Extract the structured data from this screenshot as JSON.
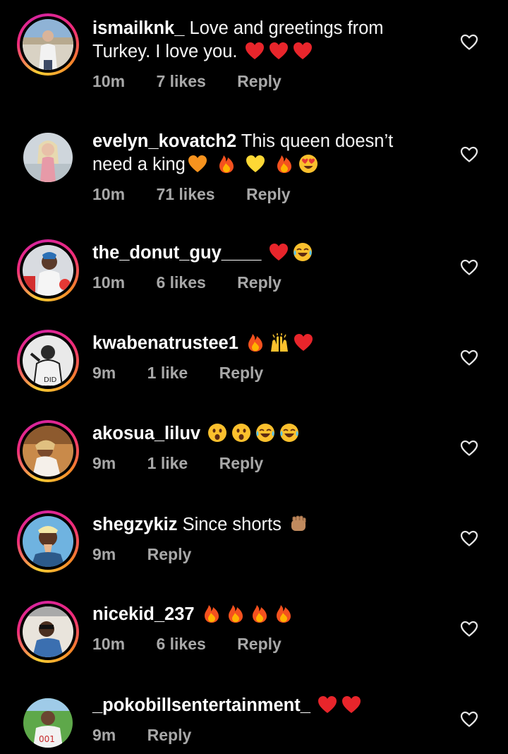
{
  "comments": [
    {
      "username": "ismailknk_",
      "text_line1": "Love and greetings from",
      "text_line2": "Turkey. I love you.",
      "emojis_line1": [],
      "emojis_line2": [
        "red-heart",
        "red-heart",
        "red-heart"
      ],
      "time": "10m",
      "likes": "7 likes",
      "reply": "Reply",
      "story_ring": true
    },
    {
      "username": "evelyn_kovatch2",
      "text_line1": "This queen doesn’t",
      "text_line2": "need a king",
      "emojis_line1": [],
      "emojis_line2": [
        "orange-heart",
        "fire",
        "yellow-heart",
        "fire",
        "heart-eyes"
      ],
      "time": "10m",
      "likes": "71 likes",
      "reply": "Reply",
      "story_ring": false
    },
    {
      "username": "the_donut_guy____",
      "text_line1": "",
      "emojis_line1": [
        "red-heart",
        "tears-of-joy"
      ],
      "time": "10m",
      "likes": "6 likes",
      "reply": "Reply",
      "story_ring": true
    },
    {
      "username": "kwabenatrustee1",
      "text_line1": "",
      "emojis_line1": [
        "fire",
        "raising-hands",
        "red-heart"
      ],
      "time": "9m",
      "likes": "1 like",
      "reply": "Reply",
      "story_ring": true
    },
    {
      "username": "akosua_liluv",
      "text_line1": "",
      "emojis_line1": [
        "astonished",
        "astonished",
        "tears-of-joy",
        "tears-of-joy"
      ],
      "time": "9m",
      "likes": "1 like",
      "reply": "Reply",
      "story_ring": true
    },
    {
      "username": "shegzykiz",
      "text_line1": "Since shorts",
      "emojis_line1": [
        "raised-fist"
      ],
      "time": "9m",
      "likes": "",
      "reply": "Reply",
      "story_ring": true
    },
    {
      "username": "nicekid_237",
      "text_line1": "",
      "emojis_line1": [
        "fire",
        "fire",
        "fire",
        "fire"
      ],
      "time": "10m",
      "likes": "6 likes",
      "reply": "Reply",
      "story_ring": true
    },
    {
      "username": "_pokobillsentertainment_",
      "text_line1": "",
      "emojis_line1": [
        "red-heart",
        "red-heart"
      ],
      "time": "9m",
      "likes": "",
      "reply": "Reply",
      "story_ring": false
    }
  ],
  "colors": {
    "background": "#000000",
    "meta_text": "#a8a8a8",
    "text": "#ffffff"
  }
}
